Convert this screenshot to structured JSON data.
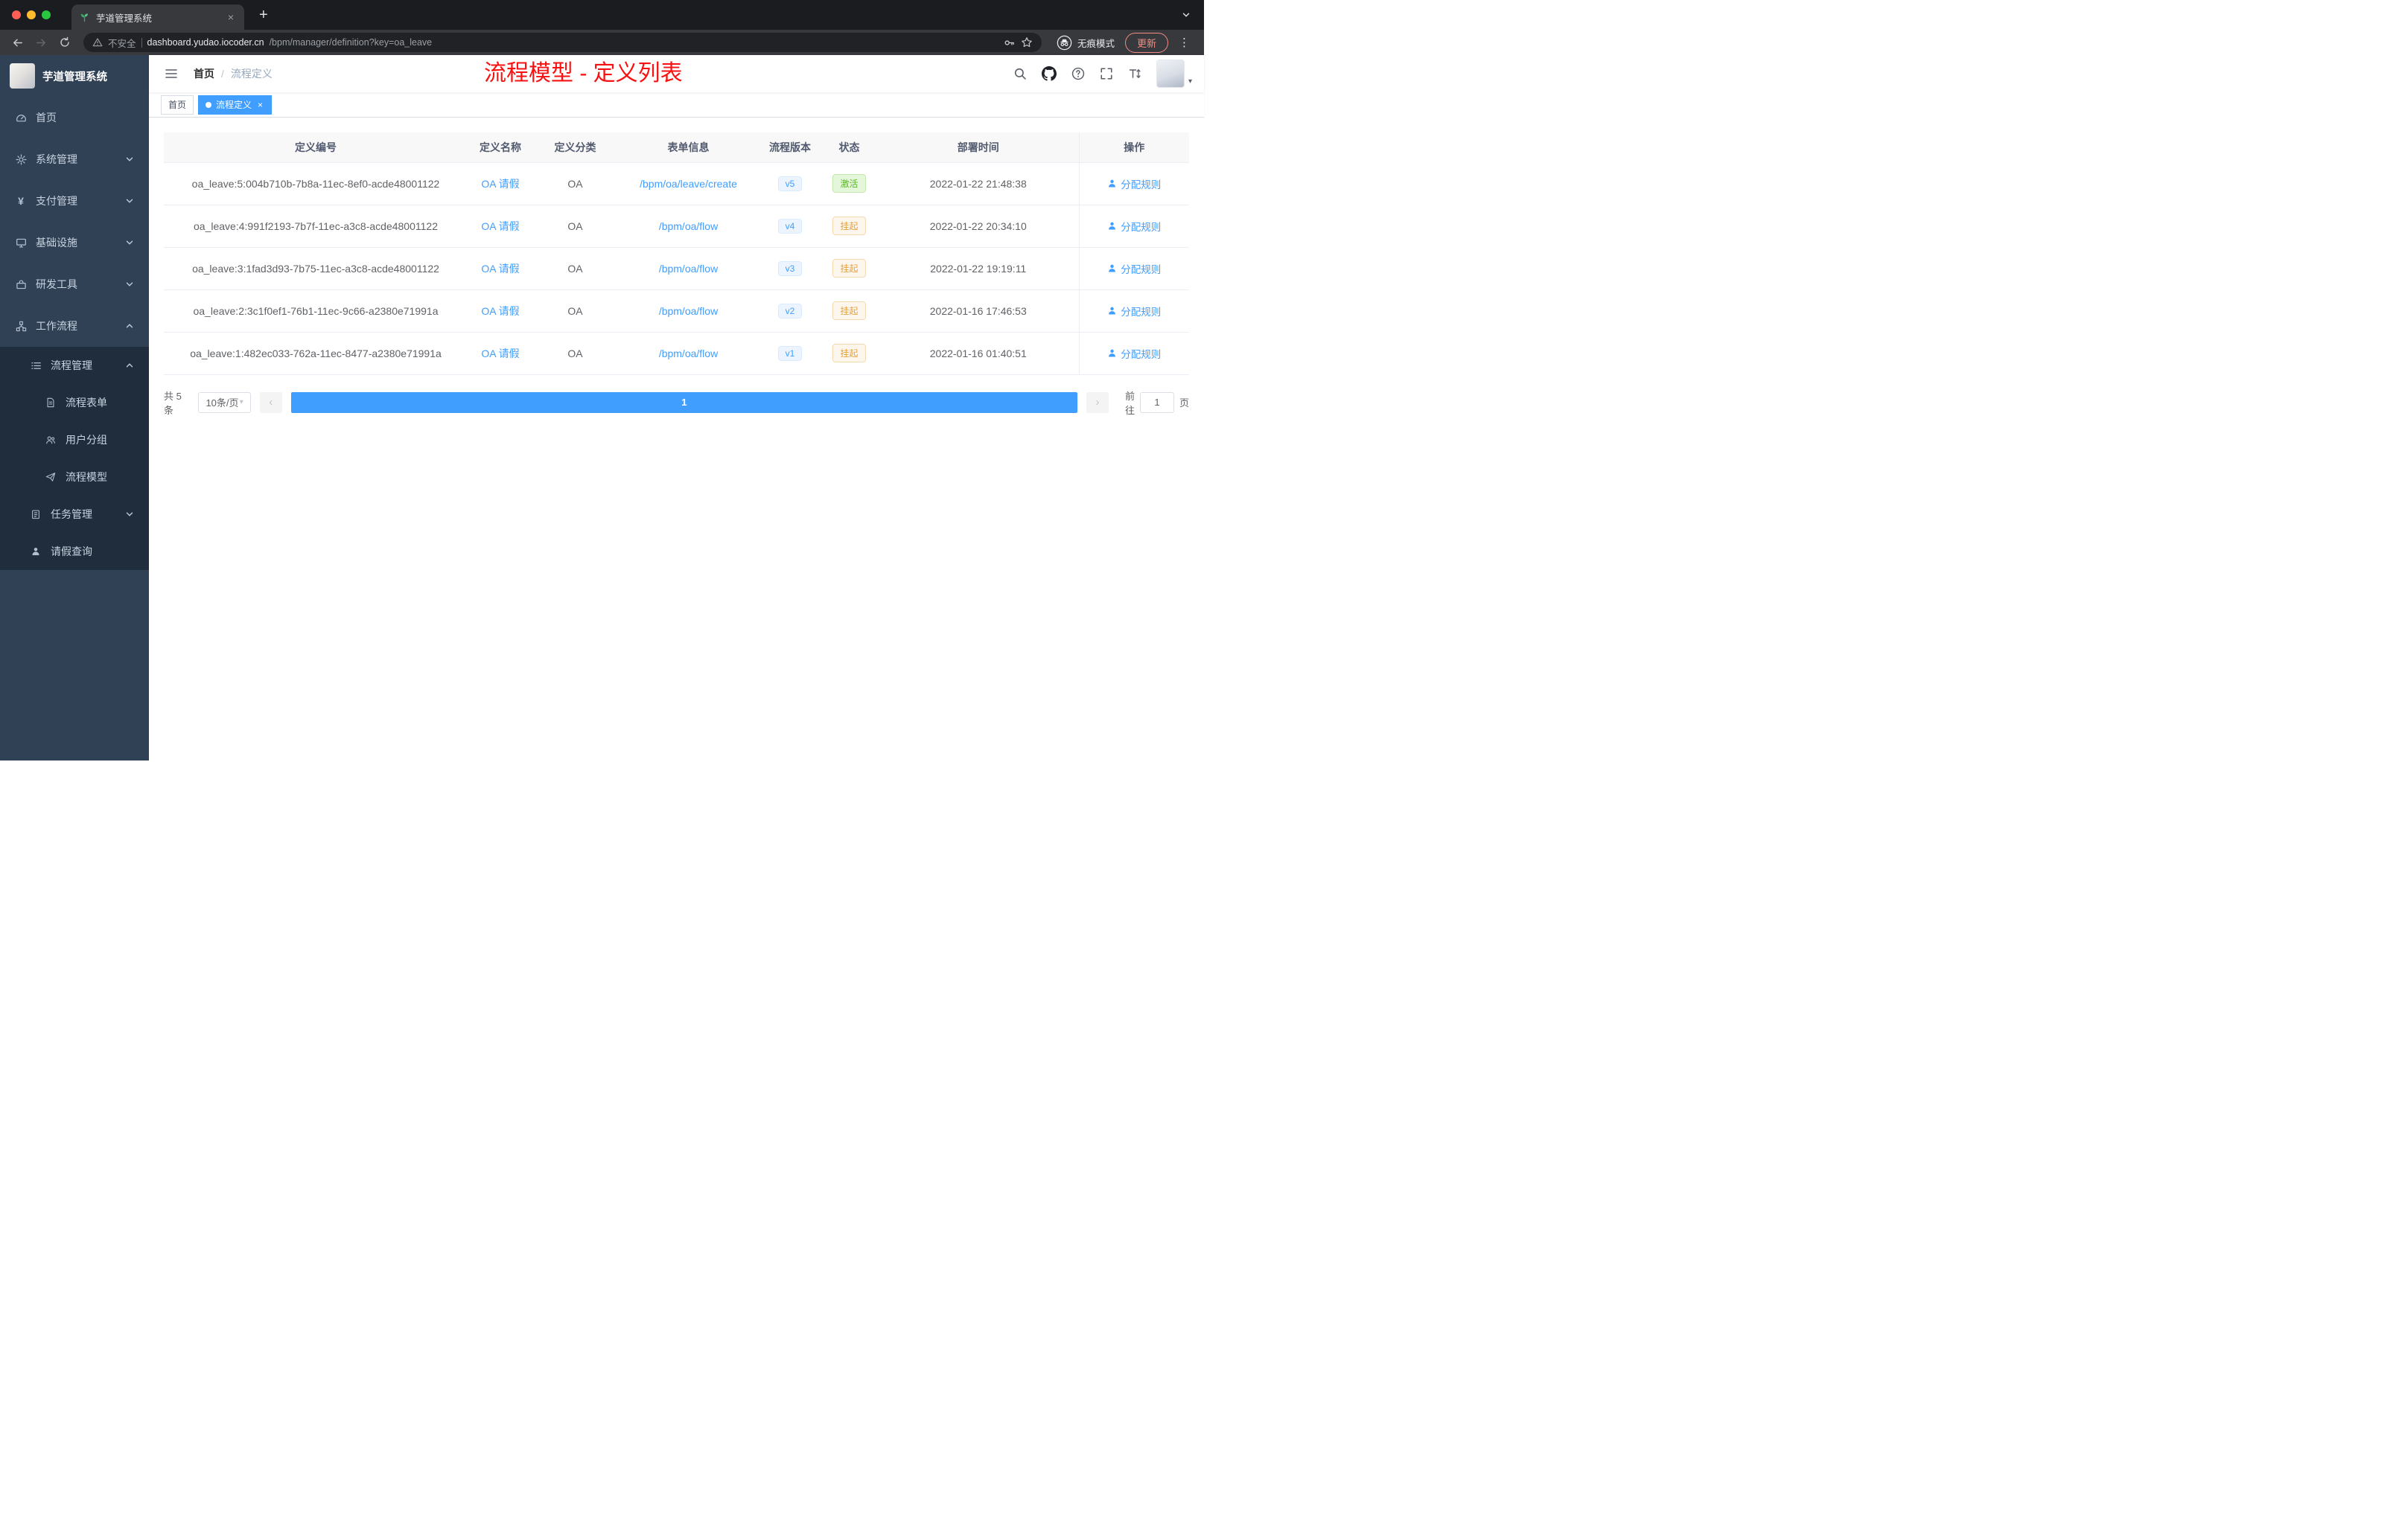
{
  "browser": {
    "tab_title": "芋道管理系统",
    "security_label": "不安全",
    "url_domain": "dashboard.yudao.iocoder.cn",
    "url_path": "/bpm/manager/definition?key=oa_leave",
    "incognito_label": "无痕模式",
    "update_label": "更新"
  },
  "sidebar": {
    "app_title": "芋道管理系统",
    "items": [
      {
        "label": "首页"
      },
      {
        "label": "系统管理"
      },
      {
        "label": "支付管理"
      },
      {
        "label": "基础设施"
      },
      {
        "label": "研发工具"
      },
      {
        "label": "工作流程"
      },
      {
        "label": "流程管理"
      },
      {
        "label": "流程表单"
      },
      {
        "label": "用户分组"
      },
      {
        "label": "流程模型"
      },
      {
        "label": "任务管理"
      },
      {
        "label": "请假查询"
      }
    ]
  },
  "header": {
    "breadcrumb": {
      "home": "首页",
      "current": "流程定义"
    },
    "overlay_title": "流程模型 - 定义列表"
  },
  "tags": {
    "home": "首页",
    "active": "流程定义"
  },
  "table": {
    "columns": [
      "定义编号",
      "定义名称",
      "定义分类",
      "表单信息",
      "流程版本",
      "状态",
      "部署时间",
      "操作"
    ],
    "rows": [
      {
        "id": "oa_leave:5:004b710b-7b8a-11ec-8ef0-acde48001122",
        "name": "OA 请假",
        "category": "OA",
        "form": "/bpm/oa/leave/create",
        "version": "v5",
        "status": "激活",
        "status_type": "active",
        "deploy_time": "2022-01-22 21:48:38",
        "action": "分配规则"
      },
      {
        "id": "oa_leave:4:991f2193-7b7f-11ec-a3c8-acde48001122",
        "name": "OA 请假",
        "category": "OA",
        "form": "/bpm/oa/flow",
        "version": "v4",
        "status": "挂起",
        "status_type": "suspended",
        "deploy_time": "2022-01-22 20:34:10",
        "action": "分配规则"
      },
      {
        "id": "oa_leave:3:1fad3d93-7b75-11ec-a3c8-acde48001122",
        "name": "OA 请假",
        "category": "OA",
        "form": "/bpm/oa/flow",
        "version": "v3",
        "status": "挂起",
        "status_type": "suspended",
        "deploy_time": "2022-01-22 19:19:11",
        "action": "分配规则"
      },
      {
        "id": "oa_leave:2:3c1f0ef1-76b1-11ec-9c66-a2380e71991a",
        "name": "OA 请假",
        "category": "OA",
        "form": "/bpm/oa/flow",
        "version": "v2",
        "status": "挂起",
        "status_type": "suspended",
        "deploy_time": "2022-01-16 17:46:53",
        "action": "分配规则"
      },
      {
        "id": "oa_leave:1:482ec033-762a-11ec-8477-a2380e71991a",
        "name": "OA 请假",
        "category": "OA",
        "form": "/bpm/oa/flow",
        "version": "v1",
        "status": "挂起",
        "status_type": "suspended",
        "deploy_time": "2022-01-16 01:40:51",
        "action": "分配规则"
      }
    ]
  },
  "pagination": {
    "total": "共 5 条",
    "page_size": "10条/页",
    "current_page": "1",
    "goto_label": "前往",
    "goto_value": "1",
    "goto_unit": "页"
  },
  "glyphs": {
    "new_tab": "+",
    "tab_close": "×",
    "tag_close": "×",
    "kebab": "⋮",
    "breadcrumb_sep": "/",
    "caret_down": "▾",
    "prev": "‹",
    "next": "›",
    "yen": "¥"
  },
  "colors": {
    "accent": "#409eff",
    "status_active": "#67c23a",
    "status_suspended": "#e6a23c",
    "overlay_title_red": "#f71111",
    "sidebar_bg": "#304156",
    "submenu_bg": "#1f2d3d"
  }
}
